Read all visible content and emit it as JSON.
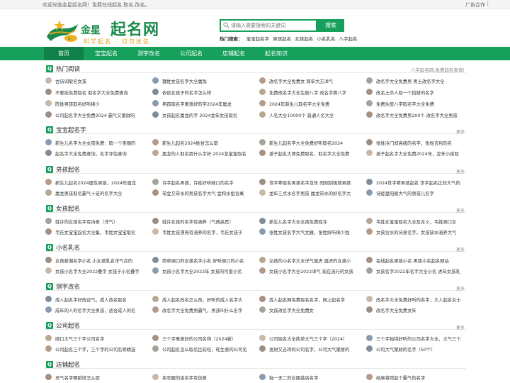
{
  "topbar": {
    "welcome": "欢迎光临金星起名网！免费在线起名,取名,改名。",
    "ad": "广告合作",
    "sep": "|"
  },
  "logo": {
    "brand_small": "金星",
    "brand_big": "起名网",
    "slogan": "科学起名 · 切勿迷信"
  },
  "search": {
    "placeholder": "请输入需要搜索的关键词",
    "button": "搜索",
    "hot_label": "热门搜索：",
    "hot_items": [
      "宝宝起名字",
      "男孩起名",
      "女孩起名",
      "小名乳名",
      "八字起名"
    ]
  },
  "nav": [
    "首页",
    "宝宝起名",
    "测字改名",
    "公司起名",
    "店铺起名",
    "起名知识"
  ],
  "colors": {
    "accent": "#16a05b",
    "accent_dark": "#10804a",
    "gold": "#e3a31d"
  },
  "sections": [
    {
      "title": "热门阅读",
      "note": "八字起名网,免费起名查询!",
      "more": "",
      "items": [
        "古诗词取名女孩",
        "魏姓女孩名字大全属兔",
        "改名字大全免费女 简单大方洋气",
        "改名字大全免费男 男士改名字大全",
        "不要挂免费取名 取名字大全免费查询",
        "依依女孩子的名字怎么样",
        "免费改名字大全生辰八字 改名字算八字",
        "改名土命人取一个招财的名字",
        "陈姓男孩取名好听稀少",
        "男孩取名字寓意好的字2024年属龙",
        "2024年新生儿取名字大全免费",
        "免费生辰八字取名字大全免费",
        "公司起名字大全免费2024 霸气又聚财的",
        "女孩起名属龙的字 2024龙年女孩取名",
        "人名大全10000个 普通人名大全",
        "改名字大全免费男200个 改名字大全男孩"
      ]
    },
    {
      "title": "宝宝起名字",
      "note": "",
      "more": "更多",
      "items": [
        "新生儿名字大全女孩免费：取一个美丽的",
        "新生儿起名2024姓甘怎么取",
        "新生儿起名字大全免费好听取名2024",
        "张姓冷门却高级的名字，张姓吉利的名",
        "起名字大全免费查询，名字评估查询",
        "属龙的人取名用什么字好 2024龙宝宝取名",
        "孩子起名大师免费取名，取名字大全免费",
        "孩子起名字大全免费2024年，龙年小孩取"
      ]
    },
    {
      "title": "男孩起名",
      "note": "",
      "more": "更多",
      "items": [
        "新生儿起名2024属性男孩，2024年属龙",
        "许字起名男孩，许姓好听顺口的名字",
        "世字辈取名男孩名字龙年 阳刚到极致男孩",
        "2024世字辈男孩起名 世字起名比较大气的",
        "属龙男孩取名霸气十足的名字大全",
        "带金又带水的男孩名字大气 金和水组合寓",
        "龙年三点水名字男孩 属龙带水的好名字大",
        "诗经里阳刚大气的男孩儿名字"
      ]
    },
    {
      "title": "女孩起名",
      "note": "",
      "more": "更多",
      "items": [
        "姓许的女孩名字有诗意（洋气）",
        "姓许女孩的名字有涵养（气质高贵）",
        "新生儿名字大全女孩免费姓许",
        "韦姓女宝宝取名大全及含义，韦姓顺口女",
        "韦氏女宝宝起名大全集，韦姓女宝宝取名",
        "韦姓女孩漂亮有涵养的名字，韦氏女孩子",
        "张姓女孩名字大气文雅，张姓好听稀少独",
        "女孩含水的诗意名字，女孩缺水涵养大气"
      ]
    },
    {
      "title": "小名乳名",
      "note": "",
      "more": "更多",
      "items": [
        "女孩新潮名字小名 小女孩乳名洋气点的",
        "简单顺口的女孩名字小名 好听顺口的小名",
        "女孩的小名字大全洋气属虎 属虎的女孩小",
        "在线起名男孩小名 男孩小名起名网站",
        "女孩小名字大全2022叠字 女孩子小名叠字",
        "女孩小名字大全2022年 女孩的可爱小名",
        "女孩小名字大全2022洋气 现在流行的女孩",
        "女孩名字2022年名字大全小名 虎年女孩乳"
      ]
    },
    {
      "title": "测字改名",
      "note": "",
      "more": "更多",
      "items": [
        "成人起名字好改运气，成人改名取名",
        "成人起名改名怎么改，好听的成人名字大",
        "成人起名网免费取名名字，网上起名字",
        "改名字大全免费好听的名字，大人起名女士",
        "成年的人的名字大全男孩，适合成人的名",
        "改名字大全免费男霸气，男孩叫什么名字",
        "女孩改名字大全免费女",
        "改名字大全免费女朱"
      ]
    },
    {
      "title": "公司起名",
      "note": "",
      "more": "更多",
      "items": [
        "顺口大气三个字公司名字",
        "三个字寓意好的公司名称（2024新）",
        "公司取名大全简单大气三个字（2024）",
        "三个字独特好听的公司名字大全，大气三个",
        "公司起名三个字，三个字的公司名称精选",
        "公司起名怎么取名比较旺，旺生意的公司名",
        "发财又吉祥的公司名字，公司大气聚财的",
        "公司大气聚财的名字（50个）"
      ]
    },
    {
      "title": "店铺起名",
      "note": "",
      "more": "",
      "items": [
        "灵气名字舞蹈班怎么取",
        "卖衣服的店名字有创意",
        "独一无二的女服装店名字",
        "给麻将馆起个霸气的名字"
      ]
    }
  ]
}
